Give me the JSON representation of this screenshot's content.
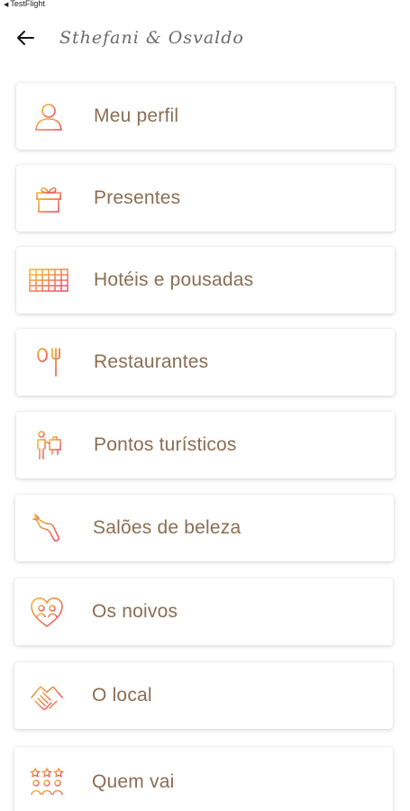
{
  "status_bar": {
    "back_app": "TestFlight"
  },
  "header": {
    "back_icon": "arrow-left-icon",
    "logo_text": "Sthefani & Osvaldo"
  },
  "colors": {
    "label": "#8a6e52",
    "icon_gradient_start": "#f5b82e",
    "icon_gradient_end": "#e8506b"
  },
  "menu": {
    "items": [
      {
        "label": "Meu perfil",
        "icon": "user-icon"
      },
      {
        "label": "Presentes",
        "icon": "gift-icon"
      },
      {
        "label": "Hotéis e pousadas",
        "icon": "hotel-icon"
      },
      {
        "label": "Restaurantes",
        "icon": "cutlery-icon"
      },
      {
        "label": "Pontos turísticos",
        "icon": "tourist-icon"
      },
      {
        "label": "Salões de beleza",
        "icon": "hairdryer-icon"
      },
      {
        "label": "Os noivos",
        "icon": "couple-heart-icon"
      },
      {
        "label": "O local",
        "icon": "handshake-icon"
      },
      {
        "label": "Quem vai",
        "icon": "guests-icon"
      }
    ]
  }
}
